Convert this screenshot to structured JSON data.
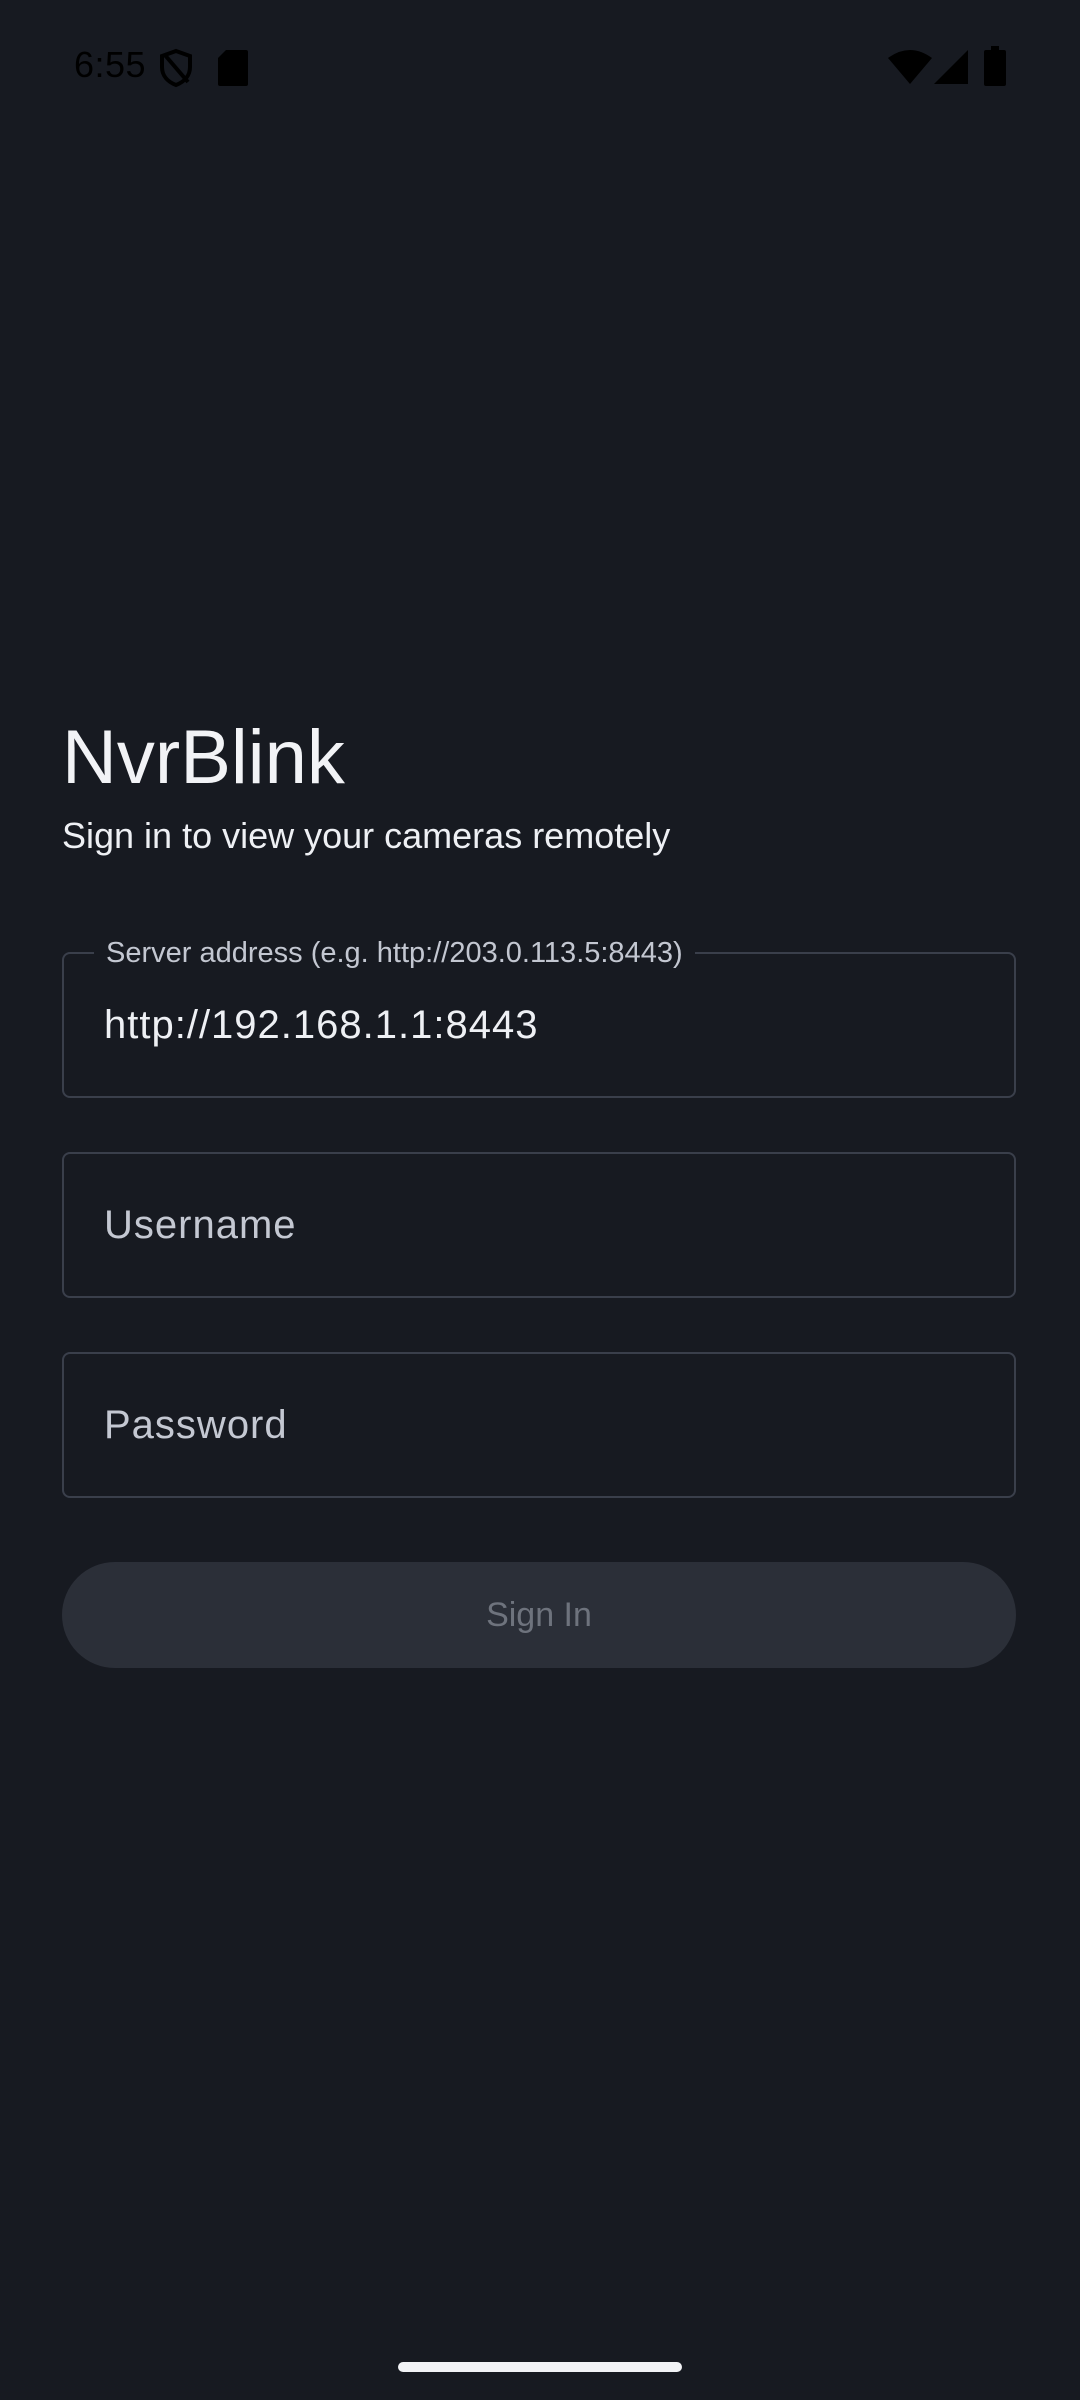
{
  "status_bar": {
    "time": "6:55",
    "icons": [
      "shield-icon",
      "sd-card-icon",
      "wifi-icon",
      "cellular-signal-icon",
      "battery-icon"
    ]
  },
  "header": {
    "title": "NvrBlink",
    "subtitle": "Sign in to view your cameras remotely"
  },
  "form": {
    "server": {
      "label": "Server address (e.g. http://203.0.113.5:8443)",
      "value": "http://192.168.1.1:8443"
    },
    "username": {
      "placeholder": "Username",
      "value": ""
    },
    "password": {
      "placeholder": "Password",
      "value": ""
    },
    "submit_label": "Sign In"
  },
  "colors": {
    "background": "#171a21",
    "field_border": "#3a3f4b",
    "button_background": "#2b2f38",
    "button_text_disabled": "#6e737d"
  }
}
